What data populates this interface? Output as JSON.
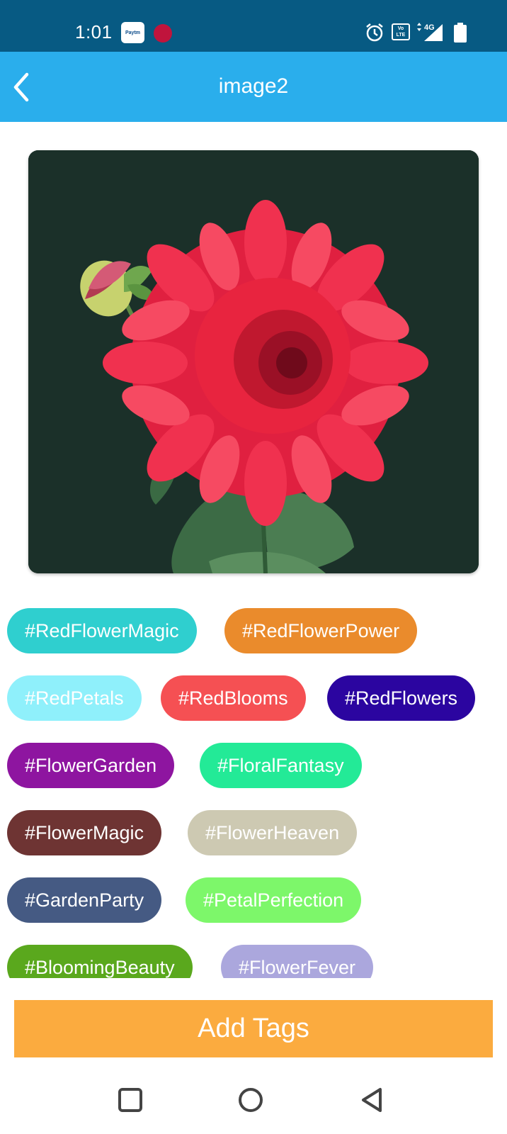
{
  "status_bar": {
    "time": "1:01",
    "paytm_label": "Paytm",
    "volte_label": "Vo LTE",
    "network_label": "4G",
    "icons": [
      "paytm-icon",
      "notification-dot-icon",
      "alarm-icon",
      "volte-icon",
      "signal-icon",
      "battery-icon"
    ],
    "color": "#075a83"
  },
  "app_bar": {
    "title": "image2",
    "back_icon": "chevron-left-icon",
    "color": "#2aaeec"
  },
  "photo": {
    "subject": "red-dahlia-flower",
    "background_color": "#1b3029"
  },
  "tags": [
    {
      "label": "#RedFlowerMagic",
      "color": "#2fcfcf"
    },
    {
      "label": "#RedFlowerPower",
      "color": "#ea8b2c"
    },
    {
      "label": "#RedPetals",
      "color": "#8ff0fb"
    },
    {
      "label": "#RedBlooms",
      "color": "#f55053"
    },
    {
      "label": "#RedFlowers",
      "color": "#2b05a0"
    },
    {
      "label": "#FlowerGarden",
      "color": "#8e15a0"
    },
    {
      "label": "#FloralFantasy",
      "color": "#23ea97"
    },
    {
      "label": "#FlowerMagic",
      "color": "#6e3433"
    },
    {
      "label": "#FlowerHeaven",
      "color": "#cdc9b2"
    },
    {
      "label": "#GardenParty",
      "color": "#455a83"
    },
    {
      "label": "#PetalPerfection",
      "color": "#7df76a"
    },
    {
      "label": "#BloomingBeauty",
      "color": "#5aa81d"
    },
    {
      "label": "#FlowerFever",
      "color": "#aba7dd"
    }
  ],
  "actions": {
    "add_tags_label": "Add Tags",
    "add_tags_color": "#fbab3f"
  },
  "nav_bar": {
    "icons": [
      "recents-square-icon",
      "home-circle-icon",
      "back-triangle-icon"
    ]
  }
}
